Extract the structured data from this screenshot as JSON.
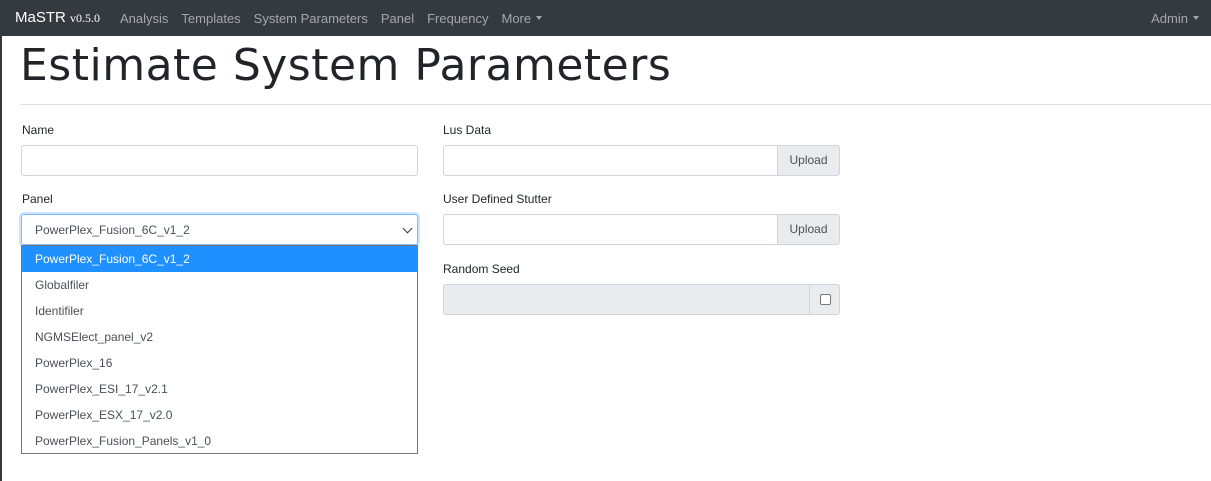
{
  "navbar": {
    "brand": "MaSTR",
    "version": "v0.5.0",
    "links": [
      "Analysis",
      "Templates",
      "System Parameters",
      "Panel",
      "Frequency"
    ],
    "more": "More",
    "user": "Admin"
  },
  "page": {
    "title": "Estimate System Parameters"
  },
  "form": {
    "name_label": "Name",
    "name_value": "",
    "panel_label": "Panel",
    "panel_selected": "PowerPlex_Fusion_6C_v1_2",
    "panel_options": [
      "PowerPlex_Fusion_6C_v1_2",
      "Globalfiler",
      "Identifiler",
      "NGMSElect_panel_v2",
      "PowerPlex_16",
      "PowerPlex_ESI_17_v2.1",
      "PowerPlex_ESX_17_v2.0",
      "PowerPlex_Fusion_Panels_v1_0"
    ],
    "lus_label": "Lus Data",
    "lus_upload": "Upload",
    "stutter_label": "User Defined Stutter",
    "stutter_upload": "Upload",
    "seed_label": "Random Seed"
  }
}
